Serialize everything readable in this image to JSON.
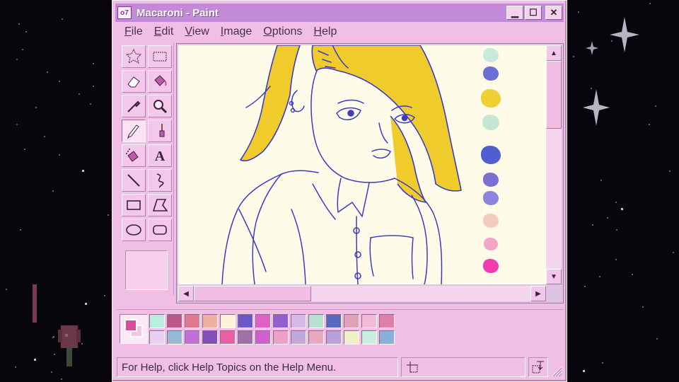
{
  "window": {
    "title": "Macaroni - Paint",
    "app_icon_text": "o7",
    "controls": {
      "minimize": "▁",
      "maximize": "☐",
      "close": "✕"
    }
  },
  "menu": [
    {
      "label": "File",
      "ul": "F",
      "rest": "ile"
    },
    {
      "label": "Edit",
      "ul": "E",
      "rest": "dit"
    },
    {
      "label": "View",
      "ul": "V",
      "rest": "iew"
    },
    {
      "label": "Image",
      "ul": "I",
      "rest": "mage"
    },
    {
      "label": "Options",
      "ul": "O",
      "rest": "ptions"
    },
    {
      "label": "Help",
      "ul": "H",
      "rest": "elp"
    }
  ],
  "tools": [
    {
      "name": "free-form-select-icon"
    },
    {
      "name": "select-icon"
    },
    {
      "name": "eraser-icon"
    },
    {
      "name": "fill-bucket-icon"
    },
    {
      "name": "color-picker-icon"
    },
    {
      "name": "magnifier-icon"
    },
    {
      "name": "pencil-icon",
      "active": true
    },
    {
      "name": "brush-icon"
    },
    {
      "name": "airbrush-icon"
    },
    {
      "name": "text-icon"
    },
    {
      "name": "line-icon"
    },
    {
      "name": "curve-icon"
    },
    {
      "name": "rectangle-icon"
    },
    {
      "name": "polygon-icon"
    },
    {
      "name": "ellipse-icon"
    },
    {
      "name": "rounded-rectangle-icon"
    }
  ],
  "palette": {
    "foreground": "#d24f9a",
    "background": "#f4c3e8",
    "colors": [
      "#b8eede",
      "#c0558c",
      "#e0788e",
      "#f0b0a0",
      "#fff2d8",
      "#6b58c8",
      "#e060c8",
      "#9060d0",
      "#d8b8e8",
      "#b8e0d0",
      "#5868c0",
      "#e0a0b8",
      "#f4b8d8",
      "#e080a8",
      "#e8d0f0",
      "#98b8d8",
      "#c070d8",
      "#8050b8",
      "#e860a0",
      "#a070a8",
      "#d060d0",
      "#f0a0c8",
      "#c0a8d8",
      "#e8a8c0",
      "#b8a0d8",
      "#f0f0c8",
      "#c8f0e0",
      "#88b0d8"
    ]
  },
  "canvas_swatches": [
    "#c8eadc",
    "#6a6fd6",
    "#f0cf36",
    "#c6e6d4",
    "#4f5fd0",
    "#7a70d4",
    "#8a84dc",
    "#f6cbbf",
    "#f2a6c6",
    "#f03cb0"
  ],
  "status": {
    "help_text": "For Help, click Help Topics on the Help Menu."
  }
}
